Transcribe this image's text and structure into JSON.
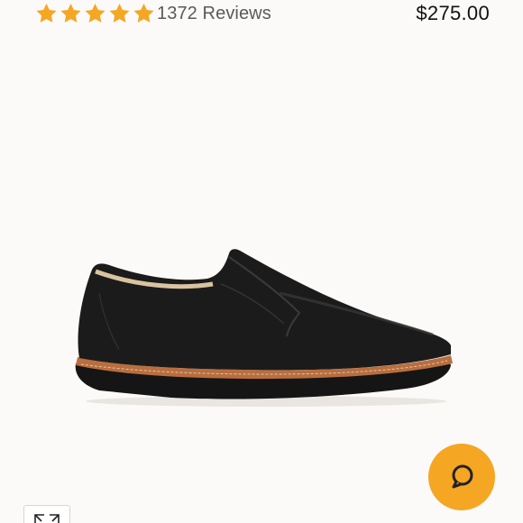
{
  "product": {
    "rating": 5,
    "rating_max": 5,
    "reviews_label": "1372 Reviews",
    "price": "$275.00"
  },
  "image": {
    "alt": "Black leather slip-on shoe with tan wedge sole"
  },
  "icons": {
    "star": "star-icon",
    "chat": "chat-bubble-icon",
    "expand": "expand-icon"
  },
  "colors": {
    "accent": "#f5a623",
    "background": "#fbfaf8",
    "price_text": "#111111",
    "reviews_text": "#5a5a5a"
  }
}
